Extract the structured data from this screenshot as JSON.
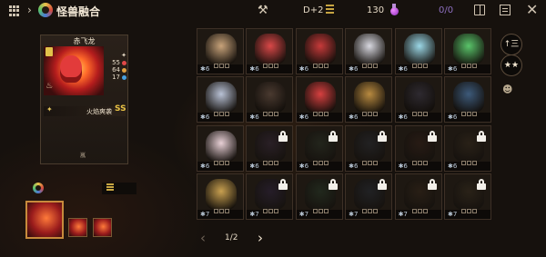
{
  "header": {
    "title": "怪兽融合",
    "rank": "D+2",
    "gold": "130",
    "capacity": "0/0",
    "icons": [
      "menu-icon",
      "chevron-right-icon",
      "fusion-emblem-icon",
      "tools-icon",
      "rank-bars-icon",
      "potion-icon",
      "book-icon",
      "note-icon",
      "close-icon"
    ]
  },
  "selected_monster": {
    "name": "赤飞龙",
    "stats": [
      {
        "value": "55",
        "color": "#e04848"
      },
      {
        "value": "64",
        "color": "#e0a040"
      },
      {
        "value": "17",
        "color": "#48a0e0"
      }
    ],
    "skill_name": "火焰爽袭",
    "skill_grade": "SS",
    "element_icon": "flame-icon",
    "footer_mark": "嵐"
  },
  "materials": {
    "count_label": ""
  },
  "grid": {
    "cells": [
      {
        "lv": "6",
        "locked": false,
        "color": "#c8a37a"
      },
      {
        "lv": "6",
        "locked": false,
        "color": "#d94848"
      },
      {
        "lv": "6",
        "locked": false,
        "color": "#c63a3a"
      },
      {
        "lv": "6",
        "locked": false,
        "color": "#d8d8e0"
      },
      {
        "lv": "6",
        "locked": false,
        "color": "#9bd7e6"
      },
      {
        "lv": "6",
        "locked": false,
        "color": "#5ac46a"
      },
      {
        "lv": "6",
        "locked": false,
        "color": "#b9c2d6"
      },
      {
        "lv": "6",
        "locked": false,
        "color": "#4a3a30"
      },
      {
        "lv": "6",
        "locked": false,
        "color": "#d64040"
      },
      {
        "lv": "6",
        "locked": false,
        "color": "#b88a40"
      },
      {
        "lv": "6",
        "locked": false,
        "color": "#2e2a30"
      },
      {
        "lv": "6",
        "locked": false,
        "color": "#3d5a7a"
      },
      {
        "lv": "6",
        "locked": false,
        "color": "#e8d0d6"
      },
      {
        "lv": "6",
        "locked": true,
        "color": "#3a2440"
      },
      {
        "lv": "6",
        "locked": true,
        "color": "#24321f"
      },
      {
        "lv": "6",
        "locked": true,
        "color": "#242a36"
      },
      {
        "lv": "6",
        "locked": true,
        "color": "#3a1c10"
      },
      {
        "lv": "6",
        "locked": true,
        "color": "#3a2814"
      },
      {
        "lv": "7",
        "locked": false,
        "color": "#c8a050"
      },
      {
        "lv": "7",
        "locked": true,
        "color": "#30204a"
      },
      {
        "lv": "7",
        "locked": true,
        "color": "#1c3a20"
      },
      {
        "lv": "7",
        "locked": true,
        "color": "#202a3a"
      },
      {
        "lv": "7",
        "locked": true,
        "color": "#3a2410"
      },
      {
        "lv": "7",
        "locked": true,
        "color": "#3a2a14"
      }
    ]
  },
  "side_buttons": {
    "sort_label": "↑三",
    "stars_label": "★★"
  },
  "pagination": {
    "page_text": "1/2"
  }
}
